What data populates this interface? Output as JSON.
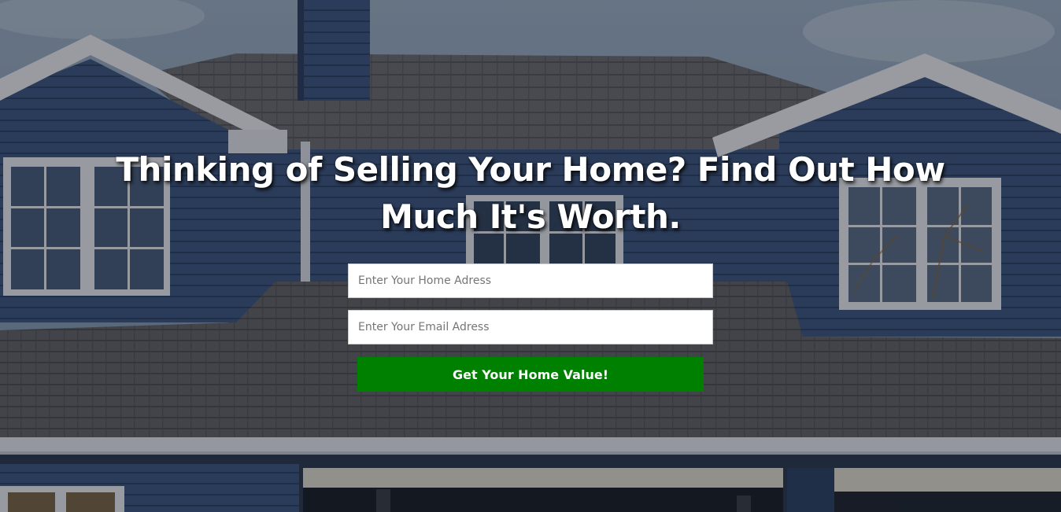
{
  "hero": {
    "headline": "Thinking of Selling Your Home? Find Out How Much It's Worth."
  },
  "form": {
    "address_placeholder": "Enter Your Home Adress",
    "address_value": "",
    "email_placeholder": "Enter Your Email Adress",
    "email_value": "",
    "submit_label": "Get Your Home Value!"
  },
  "colors": {
    "button": "#008000",
    "text": "#ffffff",
    "siding": "#3e5a86",
    "roof": "#6e6e70",
    "sky": "#8fa8c2"
  }
}
